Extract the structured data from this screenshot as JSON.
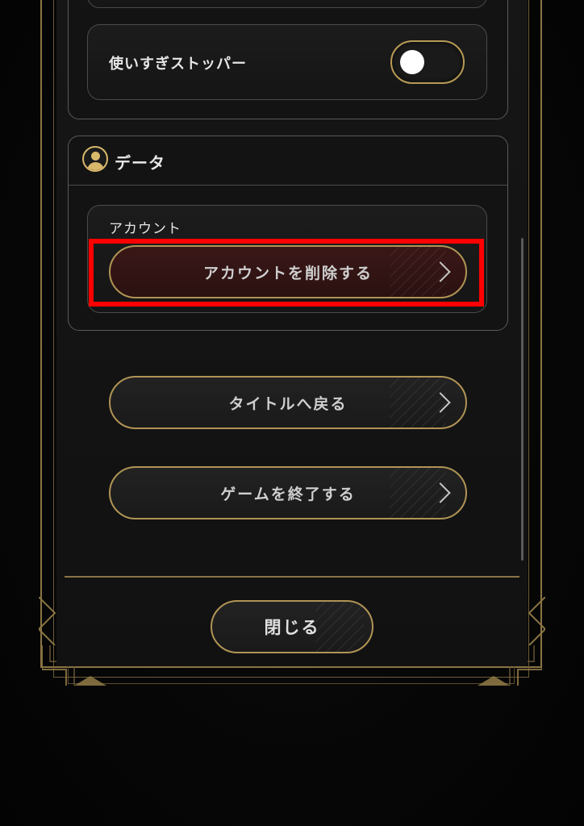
{
  "settings": {
    "overuse_stopper": {
      "label": "使いすぎストッパー",
      "enabled": false
    }
  },
  "data_section": {
    "title": "データ",
    "icon": "user-icon",
    "account": {
      "label": "アカウント",
      "delete_button": "アカウントを削除する"
    }
  },
  "actions": {
    "return_title": "タイトルへ戻る",
    "quit_game": "ゲームを終了する"
  },
  "footer": {
    "close_button": "閉じる"
  },
  "colors": {
    "gold": "#b09455",
    "danger_bg": "#3a1717",
    "highlight": "#ff0000"
  }
}
